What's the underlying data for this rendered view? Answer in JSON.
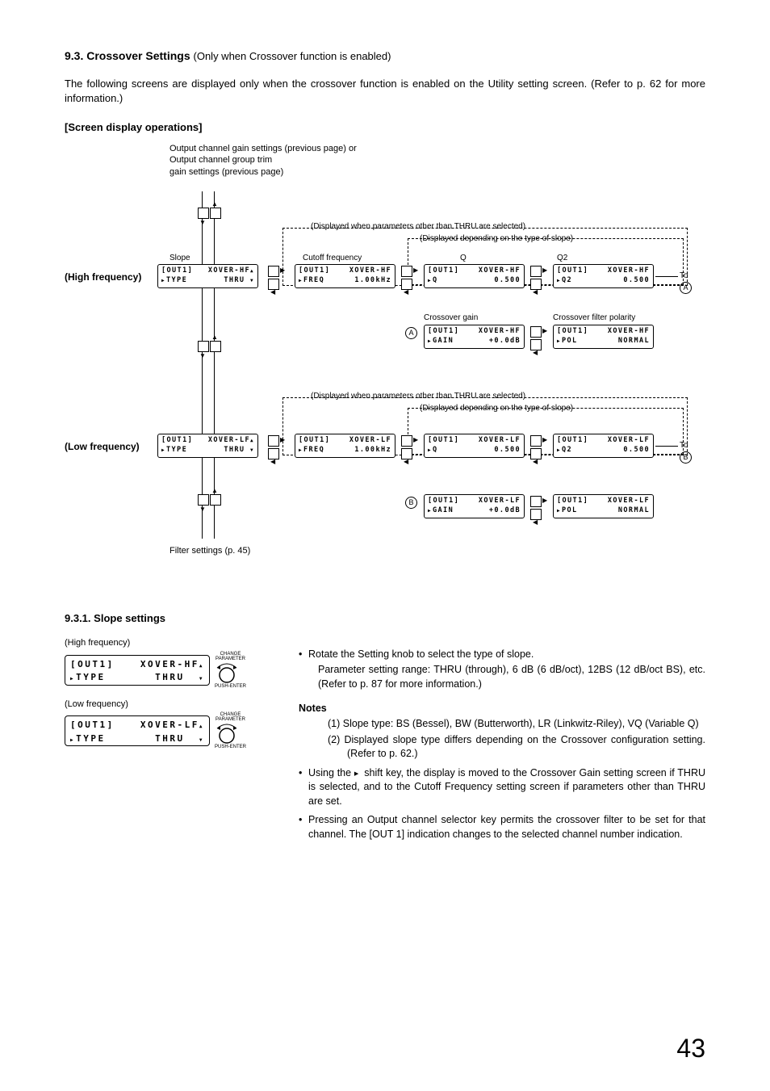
{
  "section": {
    "number": "9.3.",
    "title": "Crossover Settings",
    "subtitle": "(Only when Crossover function is enabled)",
    "intro": "The following screens are displayed only when the crossover function is enabled on the Utility setting screen. (Refer to p. 62 for more information.)",
    "ops_heading": "[Screen display operations]"
  },
  "diagram": {
    "top_caption": "Output channel gain settings (previous page) or\nOutput channel group trim\ngain settings (previous page)",
    "hf_label": "(High frequency)",
    "lf_label": "(Low frequency)",
    "slope_label": "Slope",
    "cutoff_label": "Cutoff frequency",
    "q_label": "Q",
    "q2_label": "Q2",
    "xgain_label": "Crossover gain",
    "xpol_label": "Crossover filter polarity",
    "disp_when_param": "(Displayed when parameters other than THRU are selected)",
    "disp_depending": "(Displayed depending on the type of slope)",
    "filter_settings": "Filter settings (p. 45)",
    "to_a": "To",
    "to_b": "To",
    "letter_a": "A",
    "letter_b": "B",
    "screens": {
      "hf_type": {
        "line1_l": "[OUT1]",
        "line1_r": "XOVER-HF",
        "line2_l": "TYPE",
        "line2_r": "THRU"
      },
      "hf_freq": {
        "line1_l": "[OUT1]",
        "line1_r": "XOVER-HF",
        "line2_l": "FREQ",
        "line2_r": "1.00kHz"
      },
      "hf_q": {
        "line1_l": "[OUT1]",
        "line1_r": "XOVER-HF",
        "line2_l": "Q",
        "line2_r": "0.500"
      },
      "hf_q2": {
        "line1_l": "[OUT1]",
        "line1_r": "XOVER-HF",
        "line2_l": "Q2",
        "line2_r": "0.500"
      },
      "hf_gain": {
        "line1_l": "[OUT1]",
        "line1_r": "XOVER-HF",
        "line2_l": "GAIN",
        "line2_r": "+0.0dB"
      },
      "hf_pol": {
        "line1_l": "[OUT1]",
        "line1_r": "XOVER-HF",
        "line2_l": "POL",
        "line2_r": "NORMAL"
      },
      "lf_type": {
        "line1_l": "[OUT1]",
        "line1_r": "XOVER-LF",
        "line2_l": "TYPE",
        "line2_r": "THRU"
      },
      "lf_freq": {
        "line1_l": "[OUT1]",
        "line1_r": "XOVER-LF",
        "line2_l": "FREQ",
        "line2_r": "1.00kHz"
      },
      "lf_q": {
        "line1_l": "[OUT1]",
        "line1_r": "XOVER-LF",
        "line2_l": "Q",
        "line2_r": "0.500"
      },
      "lf_q2": {
        "line1_l": "[OUT1]",
        "line1_r": "XOVER-LF",
        "line2_l": "Q2",
        "line2_r": "0.500"
      },
      "lf_gain": {
        "line1_l": "[OUT1]",
        "line1_r": "XOVER-LF",
        "line2_l": "GAIN",
        "line2_r": "+0.0dB"
      },
      "lf_pol": {
        "line1_l": "[OUT1]",
        "line1_r": "XOVER-LF",
        "line2_l": "POL",
        "line2_r": "NORMAL"
      }
    }
  },
  "subsection": {
    "number": "9.3.1.",
    "title": "Slope settings",
    "hf_disp_label": "(High frequency)",
    "lf_disp_label": "(Low frequency)",
    "hf_screen": {
      "line1_l": "[OUT1]",
      "line1_r": "XOVER-HF",
      "line2_l": "TYPE",
      "line2_r": "THRU"
    },
    "lf_screen": {
      "line1_l": "[OUT1]",
      "line1_r": "XOVER-LF",
      "line2_l": "TYPE",
      "line2_r": "THRU"
    },
    "knob_top": "CHANGE\nPARAMETER",
    "knob_bottom": "PUSH-ENTER",
    "bullet1": "Rotate the Setting knob to select the type of slope.",
    "bullet1_sub": "Parameter setting range: THRU (through), 6 dB (6 dB/oct), 12BS (12 dB/oct BS), etc. (Refer to p. 87 for more information.)",
    "notes_heading": "Notes",
    "note1_num": "(1)",
    "note1": "Slope type: BS (Bessel), BW (Butterworth), LR (Linkwitz-Riley), VQ (Variable Q)",
    "note2_num": "(2)",
    "note2": "Displayed slope type differs depending on the Crossover configuration setting. (Refer to p. 62.)",
    "bullet2_pre": "Using the ",
    "bullet2_post": " shift key, the display is moved to the Crossover Gain setting screen if THRU is selected, and to the Cutoff Frequency setting screen if parameters other than THRU are set.",
    "bullet3": "Pressing an Output channel selector key permits the crossover filter to be set for that channel. The [OUT 1] indication changes to the selected channel number indication."
  },
  "page_number": "43"
}
